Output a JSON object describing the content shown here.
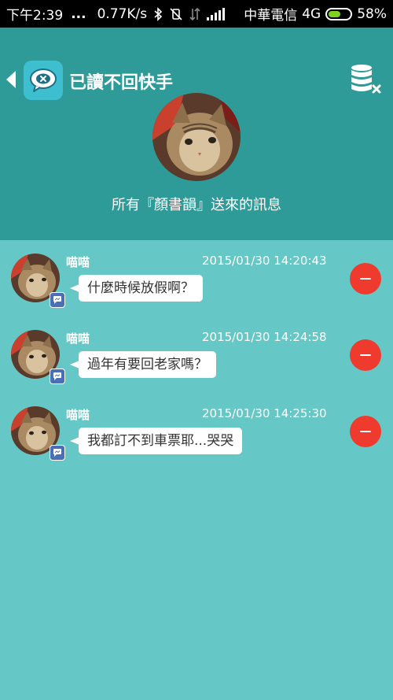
{
  "status_bar": {
    "time": "下午2:39",
    "dots": "...",
    "speed": "0.77K/s",
    "carrier": "中華電信",
    "network": "4G",
    "battery": "58%"
  },
  "header": {
    "title": "已讀不回快手",
    "source_label": "所有『顏書韻』送來的訊息"
  },
  "messages": [
    {
      "sender": "喵喵",
      "time": "2015/01/30 14:20:43",
      "text": "什麼時候放假啊？"
    },
    {
      "sender": "喵喵",
      "time": "2015/01/30 14:24:58",
      "text": "過年有要回老家嗎？"
    },
    {
      "sender": "喵喵",
      "time": "2015/01/30 14:25:30",
      "text": "我都訂不到車票耶...哭哭"
    }
  ],
  "colors": {
    "status_bar": "#000000",
    "header": "#2f9b98",
    "list_background": "#66c8c6",
    "delete": "#ef3b2d",
    "facebook_badge": "#4a6fb5",
    "battery_fill": "#7ed321"
  },
  "icons": {
    "back": "back-arrow-icon",
    "app": "chat-bubble-x-icon",
    "clear": "database-clear-icon",
    "delete": "minus-circle-icon",
    "badge": "messenger-icon"
  }
}
